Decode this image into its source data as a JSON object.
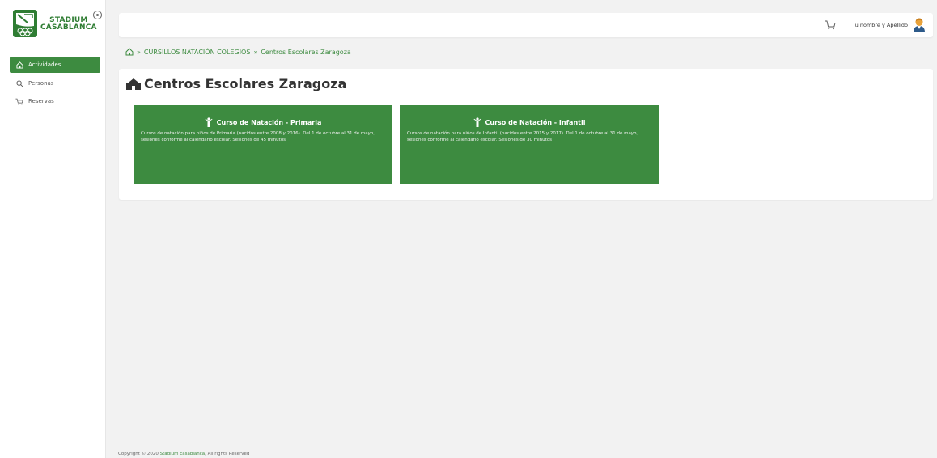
{
  "brand": {
    "line1": "STADIUM",
    "line2": "CASABLANCA",
    "color": "#2f7d33"
  },
  "sidebar": {
    "items": [
      {
        "label": "Actividades",
        "icon": "home-icon",
        "active": true
      },
      {
        "label": "Personas",
        "icon": "search-icon",
        "active": false
      },
      {
        "label": "Reservas",
        "icon": "cart-icon",
        "active": false
      }
    ]
  },
  "topbar": {
    "user_name": "Tu nombre y Apellido",
    "cart_icon": "cart-icon",
    "avatar_icon": "user-avatar-icon"
  },
  "breadcrumb": {
    "home_icon": "home-icon",
    "separator": "»",
    "items": [
      "CURSILLOS NATACIÓN COLEGIOS",
      "Centros Escolares Zaragoza"
    ]
  },
  "page": {
    "title": "Centros Escolares Zaragoza",
    "title_icon": "building-icon"
  },
  "activities": [
    {
      "title": "Curso de Natación - Primaria",
      "icon": "person-icon",
      "description": "Cursos de natación para niños de Primaria (nacidos entre 2008 y 2016). Del 1 de octubre al 31 de mayo, sesiones conforme al calendario escolar. Sesiones de 45 minutos"
    },
    {
      "title": "Curso de Natación - Infantil",
      "icon": "person-icon",
      "description": "Cursos de natación para niños de Infantil (nacidos entre 2015 y 2017). Del 1 de octubre al 31 de mayo, sesiones conforme al calendario escolar. Sesiones de 30 minutos"
    }
  ],
  "footer": {
    "prefix": "Copyright © 2020 ",
    "brand": "Stadium casablanca",
    "suffix": ", All rights Reserved"
  },
  "colors": {
    "accent": "#3d8b40",
    "background": "#f2f2f2"
  }
}
